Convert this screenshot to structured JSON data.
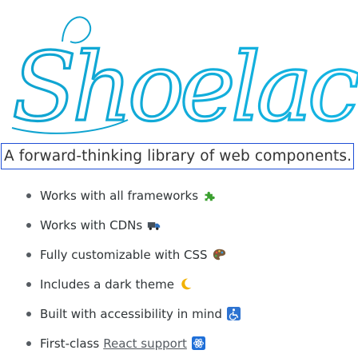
{
  "brand": {
    "logo_text": "Shoelace",
    "logo_color": "#0fa3d0",
    "logo_stroke_dark": "#0b84a9"
  },
  "tagline": {
    "text": "A forward-thinking library of web components."
  },
  "features": [
    {
      "text": "Works with all frameworks",
      "emoji": "puzzle-piece-icon"
    },
    {
      "text": "Works with CDNs",
      "emoji": "truck-icon"
    },
    {
      "text": "Fully customizable with CSS",
      "emoji": "palette-icon"
    },
    {
      "text": "Includes a dark theme",
      "emoji": "crescent-moon-icon"
    },
    {
      "text": "Built with accessibility in mind",
      "emoji": "wheelchair-icon"
    },
    {
      "text": "First-class",
      "link": "React support",
      "emoji": "atom-icon"
    }
  ],
  "colors": {
    "tagline_border": "#1f4fd6",
    "bullet": "#555b61",
    "text": "#2f3437",
    "puzzle": "#3a9f2f",
    "truck": "#46505a",
    "palette": "#7b5b3a",
    "moon": "#f2b200",
    "wheelchair": "#2e73d1",
    "atom": "#1f6fd8"
  }
}
